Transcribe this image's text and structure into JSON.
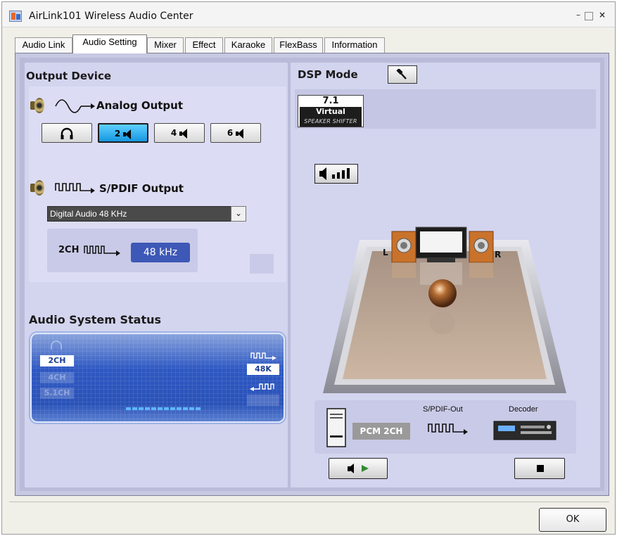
{
  "window": {
    "title": "AirLink101 Wireless Audio Center",
    "min_glyph": "–",
    "max_glyph": "",
    "close_glyph": "×"
  },
  "tabs": [
    {
      "label": "Audio Link",
      "active": false
    },
    {
      "label": "Audio Setting",
      "active": true
    },
    {
      "label": "Mixer",
      "active": false
    },
    {
      "label": "Effect",
      "active": false
    },
    {
      "label": "Karaoke",
      "active": false
    },
    {
      "label": "FlexBass",
      "active": false
    },
    {
      "label": "Information",
      "active": false
    }
  ],
  "output_device": {
    "heading": "Output Device",
    "analog": {
      "label": "Analog Output",
      "buttons": [
        {
          "label": "",
          "icon": "headphones-icon",
          "active": false
        },
        {
          "label": "2",
          "icon": "speaker-icon",
          "active": true
        },
        {
          "label": "4",
          "icon": "speaker-icon",
          "active": false
        },
        {
          "label": "6",
          "icon": "speaker-icon",
          "active": false
        }
      ]
    },
    "spdif": {
      "label": "S/PDIF Output",
      "select_value": "Digital Audio 48 KHz",
      "channel_label": "2CH",
      "rate": "48 kHz"
    }
  },
  "status": {
    "heading": "Audio System Status",
    "channels": [
      "2CH",
      "4CH",
      "5.1CH"
    ],
    "active_channel": "2CH",
    "rate_out": "48K"
  },
  "dsp": {
    "heading": "DSP Mode",
    "badge_top": "7.1",
    "badge_mid": "Virtual",
    "badge_bot": "SPEAKER SHIFTER",
    "speaker_left": "L",
    "speaker_right": "R"
  },
  "flow": {
    "pcm": "PCM 2CH",
    "spdif_out": "S/PDIF-Out",
    "decoder": "Decoder"
  },
  "colors": {
    "panel": "#c7c8e2",
    "accent": "#1597e0",
    "status_blue": "#2e58c2"
  },
  "buttons": {
    "ok": "OK"
  }
}
